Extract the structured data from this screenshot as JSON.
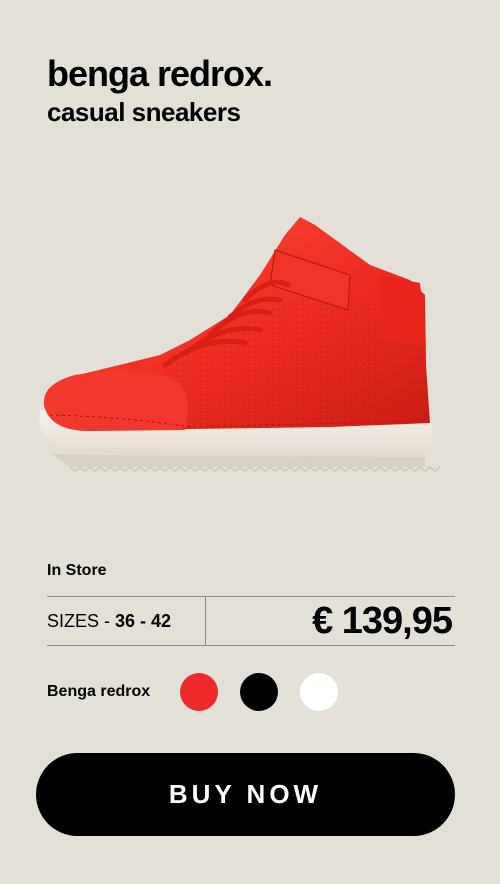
{
  "product": {
    "title": "benga redrox.",
    "subtitle": "casual sneakers",
    "image": "red-high-top-sneaker"
  },
  "availability": "In Store",
  "sizes": {
    "label": "SIZES",
    "separator": "-",
    "range": "36 - 42"
  },
  "price": "€ 139,95",
  "colors": {
    "name": "Benga redrox",
    "options": [
      {
        "name": "red",
        "hex": "#ee2a2a"
      },
      {
        "name": "black",
        "hex": "#000000"
      },
      {
        "name": "white",
        "hex": "#ffffff"
      }
    ]
  },
  "buy_button": {
    "label": "BUY NOW"
  },
  "theme": {
    "background": "#e3e0d8",
    "accent": "#000000"
  }
}
